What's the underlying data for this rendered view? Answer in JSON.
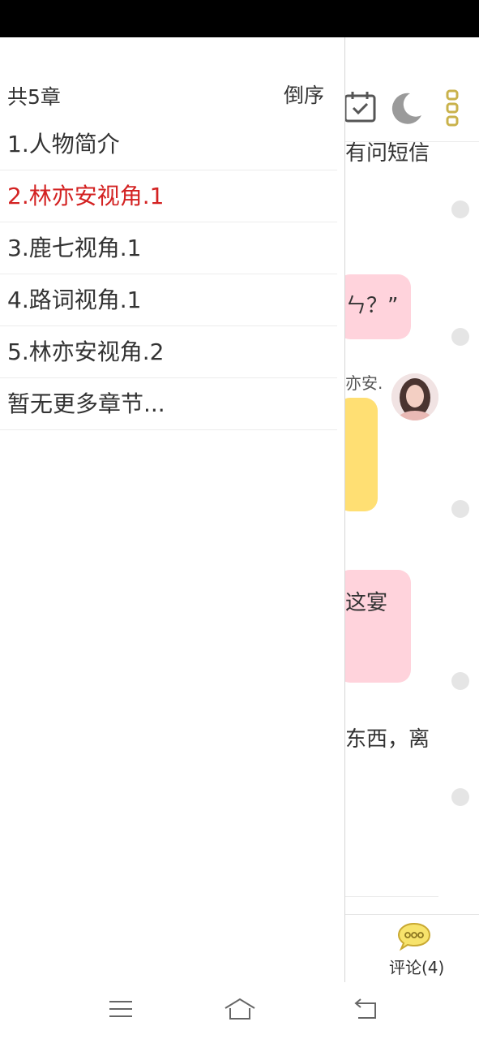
{
  "drawer": {
    "chapter_count": "共5章",
    "sort_label": "倒序",
    "chapters": [
      "1.人物简介",
      "2.林亦安视角.1",
      "3.鹿七视角.1",
      "4.路词视角.1",
      "5.林亦安视角.2",
      "暂无更多章节..."
    ],
    "active_index": 1
  },
  "reader": {
    "visible_text": {
      "line_1": "有问短信",
      "bubble_1": "ㄣ？”",
      "speaker": "亦安.",
      "bubble_3": "这宴",
      "line_2": "东西，离"
    },
    "comment_label": "评论(4)"
  },
  "colors": {
    "active_chapter": "#d32222",
    "pink_bubble": "#ffd3dc",
    "yellow_bubble": "#ffdf73"
  }
}
